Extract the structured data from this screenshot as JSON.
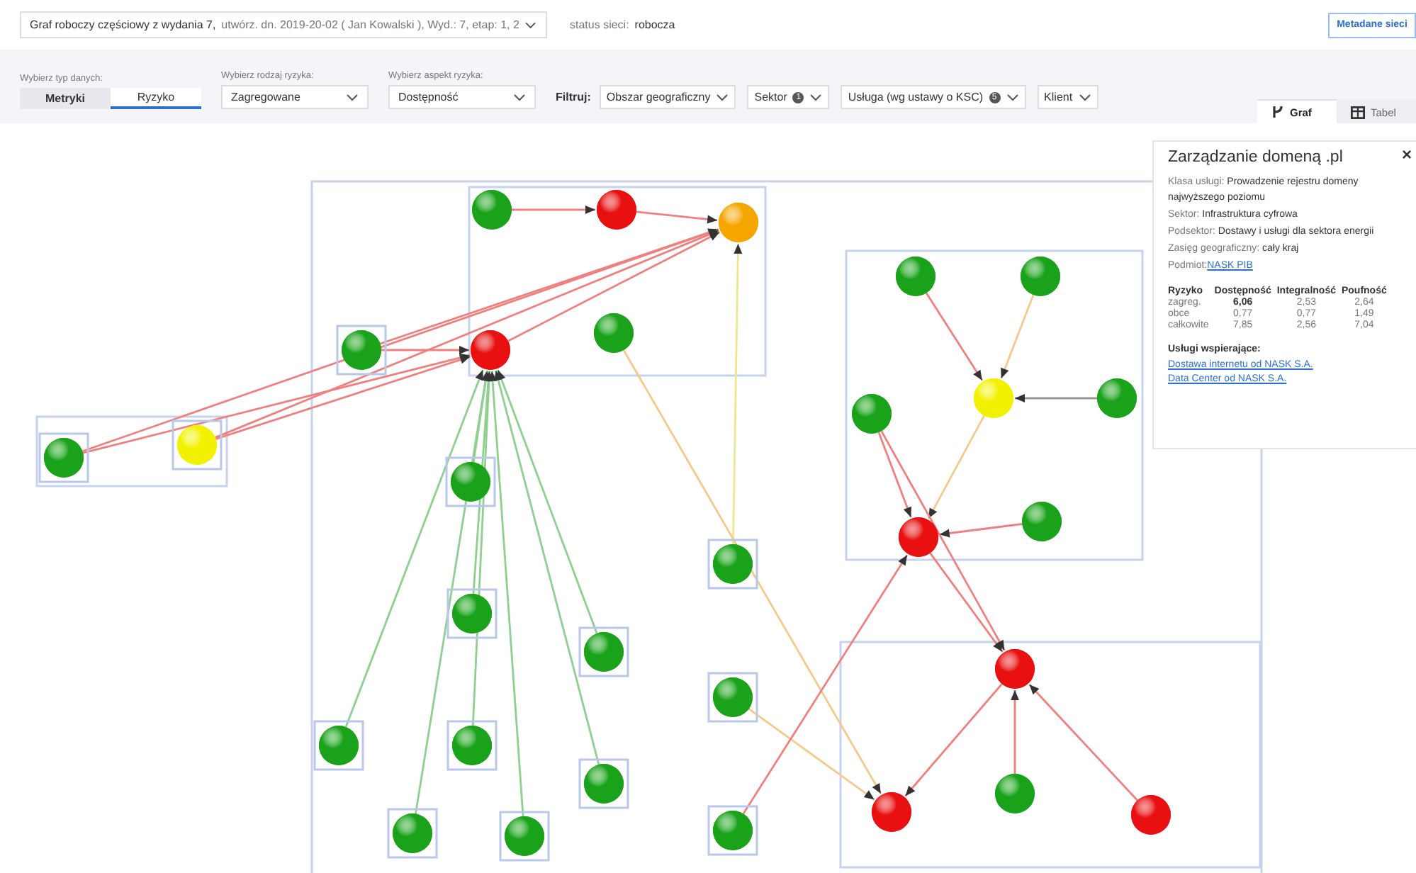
{
  "header": {
    "graph_select": "Graf roboczy częściowy z wydania 7,",
    "graph_select_details": "utwórz. dn. 2019-20-02 ( Jan Kowalski ), Wyd.: 7, etap: 1, 2",
    "status_label": "status sieci:",
    "status_value": "robocza",
    "metadata_button": "Metadane sieci"
  },
  "filters": {
    "data_type_label": "Wybierz typ danych:",
    "data_types": [
      {
        "label": "Metryki",
        "selected": false
      },
      {
        "label": "Ryzyko",
        "selected": true
      }
    ],
    "risk_type_label": "Wybierz rodzaj ryzyka:",
    "risk_type": "Zagregowane",
    "risk_aspect_label": "Wybierz aspekt ryzyka:",
    "risk_aspect": "Dostępność",
    "filter_label": "Filtruj:",
    "filter_dropdowns": [
      {
        "label": "Obszar geograficzny"
      },
      {
        "label": "Sektor",
        "badge": "1"
      },
      {
        "label": "Usługa (wg ustawy o KSC)",
        "badge": "5"
      },
      {
        "label": "Klient"
      }
    ]
  },
  "view_tabs": [
    {
      "label": "Graf",
      "selected": true,
      "kind": "graph"
    },
    {
      "label": "Tabel",
      "selected": false,
      "kind": "table"
    }
  ],
  "graph": {
    "nodes": [
      {
        "color": "#1aa31a",
        "framed": false
      },
      {
        "color": "#e81010",
        "framed": false
      },
      {
        "color": "#f5a500",
        "framed": false
      },
      {
        "color": "#1aa31a",
        "framed": true
      },
      {
        "color": "#e81010",
        "framed": false
      },
      {
        "color": "#1aa31a",
        "framed": false
      },
      {
        "color": "#1aa31a",
        "framed": true
      },
      {
        "color": "#f2f200",
        "framed": true
      },
      {
        "color": "#1aa31a",
        "framed": true
      },
      {
        "color": "#1aa31a",
        "framed": true
      },
      {
        "color": "#1aa31a",
        "framed": true
      },
      {
        "color": "#1aa31a",
        "framed": true
      },
      {
        "color": "#1aa31a",
        "framed": true
      },
      {
        "color": "#1aa31a",
        "framed": true
      },
      {
        "color": "#1aa31a",
        "framed": true
      },
      {
        "color": "#1aa31a",
        "framed": true
      },
      {
        "color": "#1aa31a",
        "framed": true
      },
      {
        "color": "#1aa31a",
        "framed": true
      },
      {
        "color": "#1aa31a",
        "framed": true
      },
      {
        "color": "#1aa31a",
        "framed": false
      },
      {
        "color": "#1aa31a",
        "framed": false
      },
      {
        "color": "#1aa31a",
        "framed": false
      },
      {
        "color": "#f2f200",
        "framed": false
      },
      {
        "color": "#1aa31a",
        "framed": false
      },
      {
        "color": "#e81010",
        "framed": false
      },
      {
        "color": "#1aa31a",
        "framed": false
      },
      {
        "color": "#e81010",
        "framed": false
      },
      {
        "color": "#e81010",
        "framed": false
      },
      {
        "color": "#1aa31a",
        "framed": false
      },
      {
        "color": "#e81010",
        "framed": false
      }
    ]
  },
  "info_panel": {
    "title": "Zarządzanie domeną .pl",
    "close": "×",
    "fields": [
      {
        "label": "Klasa usługi:",
        "value": "Prowadzenie rejestru domeny najwyższego poziomu"
      },
      {
        "label": "Sektor:",
        "value": "Infrastruktura cyfrowa"
      },
      {
        "label": "Podsektor:",
        "value": "Dostawy i usługi dla sektora energii"
      },
      {
        "label": "Zasięg geograficzny:",
        "value": "cały kraj"
      }
    ],
    "entity_label": "Podmiot:",
    "entity_link": "NASK PIB",
    "risk_table": {
      "columns": [
        "Ryzyko",
        "Dostępność",
        "Integralność",
        "Poufność"
      ],
      "rows": [
        [
          "zagreg.",
          "6,06",
          "2,53",
          "2,64"
        ],
        [
          "obce",
          "0,77",
          "0,77",
          "1,49"
        ],
        [
          "całkowite",
          "7,85",
          "2,56",
          "7,04"
        ]
      ]
    },
    "supporting_title": "Usługi wspierające:",
    "supporting_links": [
      "Dostawa internetu od NASK S.A.",
      "Data Center od NASK S.A."
    ]
  }
}
